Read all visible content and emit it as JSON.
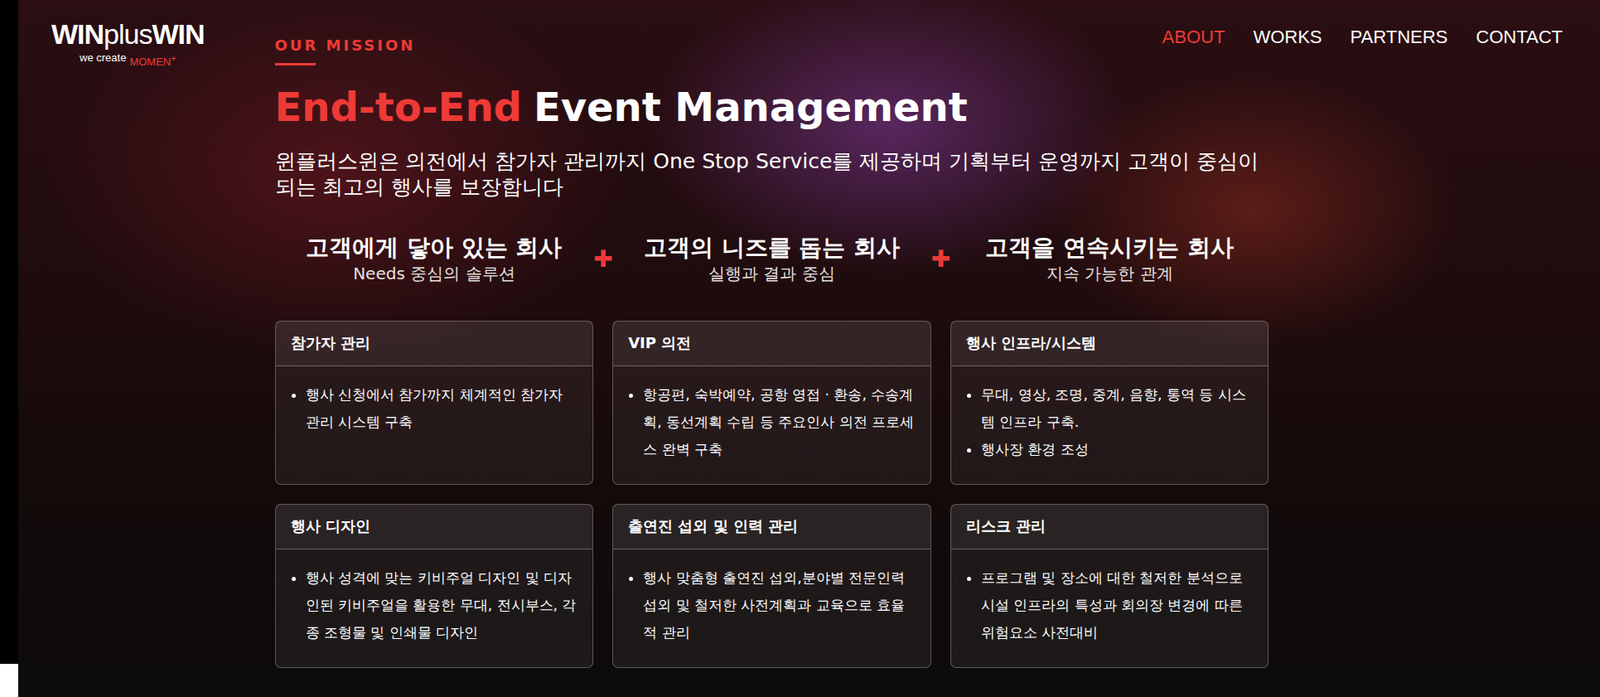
{
  "logo": {
    "name_bold_1": "WIN",
    "name_light": "plus",
    "name_bold_2": "WIN",
    "tagline": "we create",
    "tagline_accent": "MOMEN",
    "tagline_mark": "+"
  },
  "nav": [
    {
      "label": "ABOUT",
      "selected": true
    },
    {
      "label": "WORKS",
      "selected": false
    },
    {
      "label": "PARTNERS",
      "selected": false
    },
    {
      "label": "CONTACT",
      "selected": false
    }
  ],
  "section": {
    "eyebrow": "OUR MISSION",
    "title_accent": "End-to-End",
    "title_rest": "Event Management",
    "description": "윈플러스윈은 의전에서 참가자 관리까지 One Stop Service를 제공하며 기획부터 운영까지 고객이 중심이 되는 최고의 행사를 보장합니다"
  },
  "separator": "✚",
  "values": [
    {
      "title": "고객에게 닿아 있는 회사",
      "subtitle": "Needs 중심의 솔루션"
    },
    {
      "title": "고객의 니즈를 돕는 회사",
      "subtitle": "실행과 결과 중심"
    },
    {
      "title": "고객을 연속시키는 회사",
      "subtitle": "지속 가능한 관계"
    }
  ],
  "services": [
    {
      "title": "참가자 관리",
      "items": [
        "행사 신청에서 참가까지 체계적인 참가자 관리 시스템 구축"
      ]
    },
    {
      "title": "VIP 의전",
      "items": [
        "항공편, 숙박예약, 공항 영접 · 환송, 수송계획, 동선계획 수립 등 주요인사 의전 프로세스 완벽 구축"
      ]
    },
    {
      "title": "행사 인프라/시스템",
      "items": [
        "무대, 영상, 조명, 중계, 음향, 통역 등 시스템 인프라 구축.",
        "행사장 환경 조성"
      ]
    },
    {
      "title": "행사 디자인",
      "items": [
        "행사 성격에 맞는 키비주얼 디자인 및 디자인된 키비주얼을 활용한 무대, 전시부스, 각종 조형물 및 인쇄물 디자인"
      ]
    },
    {
      "title": "출연진 섭외 및 인력 관리",
      "items": [
        "행사 맞춤형 출연진 섭외,분야별 전문인력 섭외 및 철저한 사전계획과 교육으로 효율적 관리"
      ]
    },
    {
      "title": "리스크 관리",
      "items": [
        "프로그램 및 장소에 대한 철저한 분석으로 시설 인프라의 특성과 회의장 변경에 따른 위험요소 사전대비"
      ]
    }
  ]
}
